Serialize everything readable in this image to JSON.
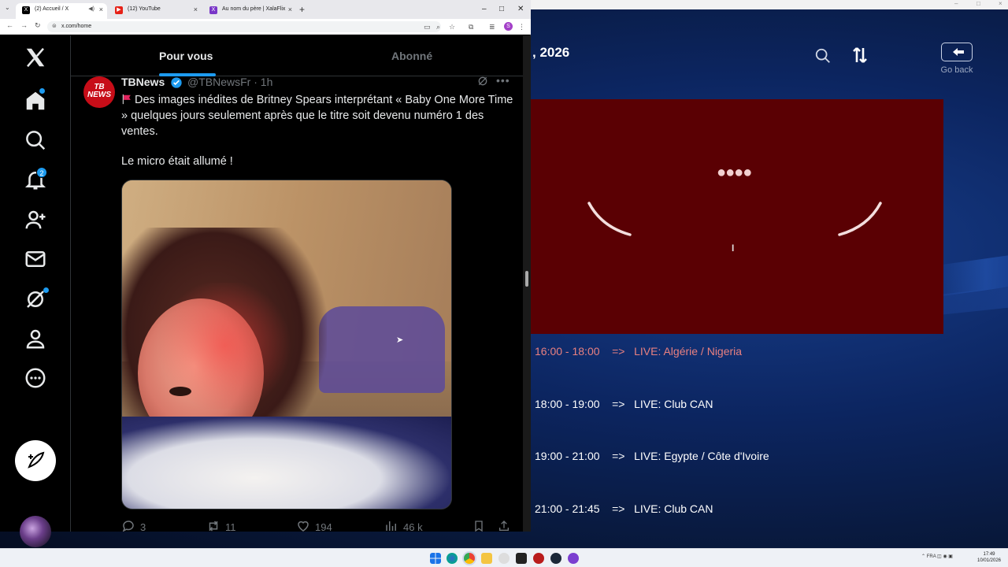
{
  "browser": {
    "tabs": [
      {
        "label": "(2) Accueil / X",
        "favicon": "x-icon",
        "active": true
      },
      {
        "label": "(12) YouTube",
        "favicon": "youtube-icon",
        "active": false
      },
      {
        "label": "Au nom du père | XalaFlix",
        "favicon": "xalaflix-icon",
        "active": false
      }
    ],
    "url": "x.com/home",
    "profile_initial": "S"
  },
  "x_app": {
    "tabs": {
      "for_you": "Pour vous",
      "following": "Abonné"
    },
    "sidebar": {
      "items": [
        "x-logo",
        "home-icon",
        "search-icon",
        "bell-icon",
        "people-icon",
        "mail-icon",
        "grok-icon",
        "profile-icon",
        "more-icon"
      ],
      "notifications_count": "2"
    },
    "tweet": {
      "author_name": "TBNews",
      "avatar_text": "TB NEWS",
      "handle": "@TBNewsFr",
      "separator": "·",
      "time": "1h",
      "text": "Des images inédites de Britney Spears interprétant « Baby One More Time » quelques jours seulement après que le titre soit devenu numéro 1 des ventes.",
      "text2": "Le micro était allumé !",
      "replies": "3",
      "reposts": "11",
      "likes": "194",
      "views": "46 k"
    }
  },
  "background_app": {
    "date_fragment": ", 2026",
    "back_label": "Go back",
    "schedule": [
      {
        "time": "16:00 - 18:00",
        "arrow": "=>",
        "event": "LIVE: Algérie / Nigeria",
        "current": true
      },
      {
        "time": "18:00 - 19:00",
        "arrow": "=>",
        "event": "LIVE: Club CAN",
        "current": false
      },
      {
        "time": "19:00 - 21:00",
        "arrow": "=>",
        "event": "LIVE: Egypte / Côte d'Ivoire",
        "current": false
      },
      {
        "time": "21:00 - 21:45",
        "arrow": "=>",
        "event": "LIVE: Club CAN",
        "current": false
      }
    ],
    "colors": {
      "player_bg": "#5a0003",
      "current_row": "#e88080"
    }
  },
  "taskbar": {
    "language": "FRA",
    "time": "17:49",
    "date": "10/01/2026"
  }
}
